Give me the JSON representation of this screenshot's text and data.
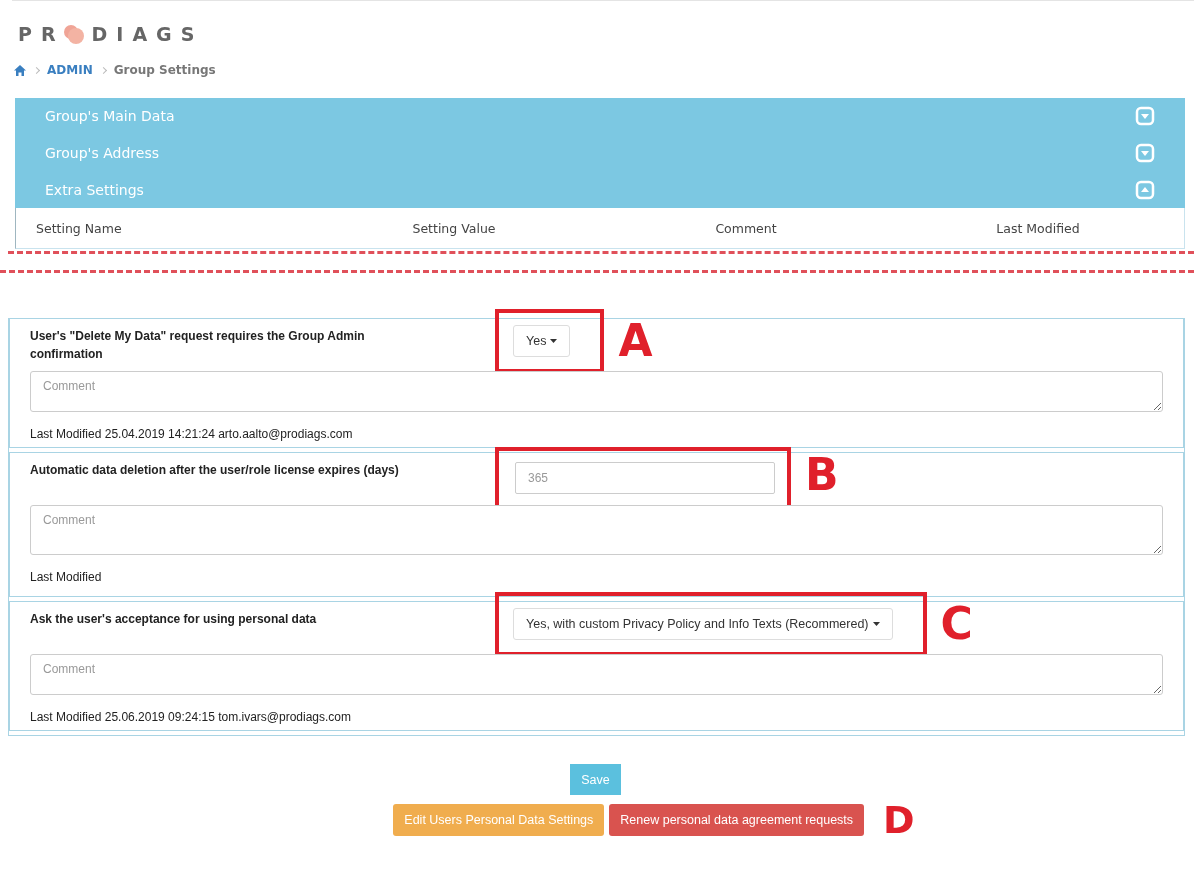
{
  "logo": {
    "text_before": "PR",
    "text_after": "DIAGS"
  },
  "breadcrumb": [
    {
      "kind": "home"
    },
    {
      "kind": "link",
      "label": "ADMIN"
    },
    {
      "kind": "current",
      "label": "Group Settings"
    }
  ],
  "sections": [
    {
      "title": "Group's Main Data",
      "expanded": false
    },
    {
      "title": "Group's Address",
      "expanded": false
    },
    {
      "title": "Extra Settings",
      "expanded": true
    }
  ],
  "table": {
    "columns": [
      "Setting Name",
      "Setting Value",
      "Comment",
      "Last Modified"
    ]
  },
  "settings": [
    {
      "label": "User's \"Delete My Data\" request requires the Group Admin confirmation",
      "kind": "select",
      "value": "Yes",
      "comment_placeholder": "Comment",
      "last_modified": "Last Modified 25.04.2019 14:21:24 arto.aalto@prodiags.com",
      "callout": "A"
    },
    {
      "label": "Automatic data deletion after the user/role license expires (days)",
      "kind": "number",
      "placeholder": "365",
      "comment_placeholder": "Comment",
      "last_modified": "Last Modified",
      "callout": "B"
    },
    {
      "label": "Ask the user's acceptance for using personal data",
      "kind": "select",
      "value": "Yes, with custom Privacy Policy and Info Texts (Recommered)",
      "comment_placeholder": "Comment",
      "last_modified": "Last Modified 25.06.2019 09:24:15 tom.ivars@prodiags.com",
      "callout": "C"
    }
  ],
  "save_button": {
    "label": "Save"
  },
  "actions": [
    {
      "label": "Edit Users Personal Data Settings",
      "kind": "warning"
    },
    {
      "label": "Renew personal data agreement requests",
      "kind": "danger"
    }
  ],
  "actions_callout": "D"
}
